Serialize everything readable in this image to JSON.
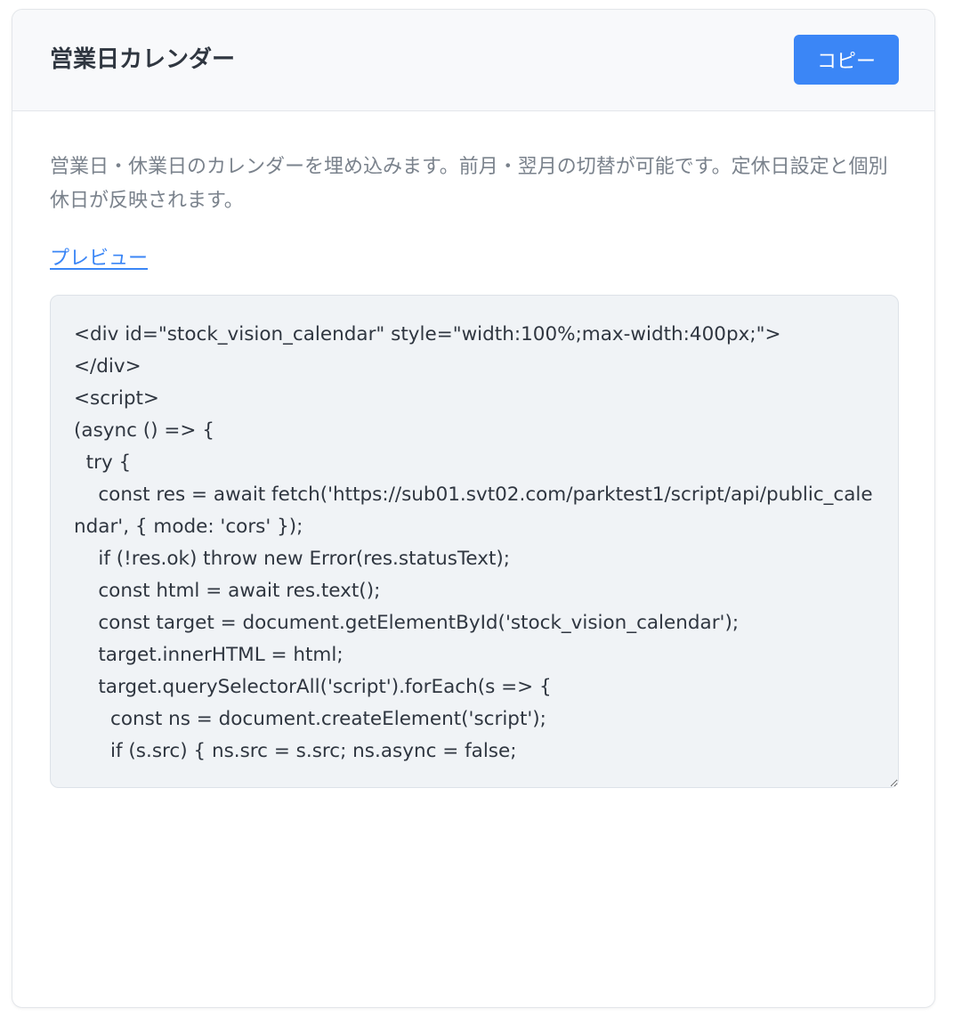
{
  "header": {
    "title": "営業日カレンダー",
    "copy_label": "コピー"
  },
  "body": {
    "description": "営業日・休業日のカレンダーを埋め込みます。前月・翌月の切替が可能です。定休日設定と個別休日が反映されます。",
    "preview_label": "プレビュー",
    "code": "<div id=\"stock_vision_calendar\" style=\"width:100%;max-width:400px;\">\n</div>\n<script>\n(async () => {\n  try {\n    const res = await fetch('https://sub01.svt02.com/parktest1/script/api/public_calendar', { mode: 'cors' });\n    if (!res.ok) throw new Error(res.statusText);\n    const html = await res.text();\n    const target = document.getElementById('stock_vision_calendar');\n    target.innerHTML = html;\n    target.querySelectorAll('script').forEach(s => {\n      const ns = document.createElement('script');\n      if (s.src) { ns.src = s.src; ns.async = false;"
  },
  "colors": {
    "accent": "#3b86f6",
    "title_text": "#2f3640",
    "muted_text": "#7a828c",
    "code_background": "#f0f3f6",
    "header_background": "#f8f9fb"
  }
}
